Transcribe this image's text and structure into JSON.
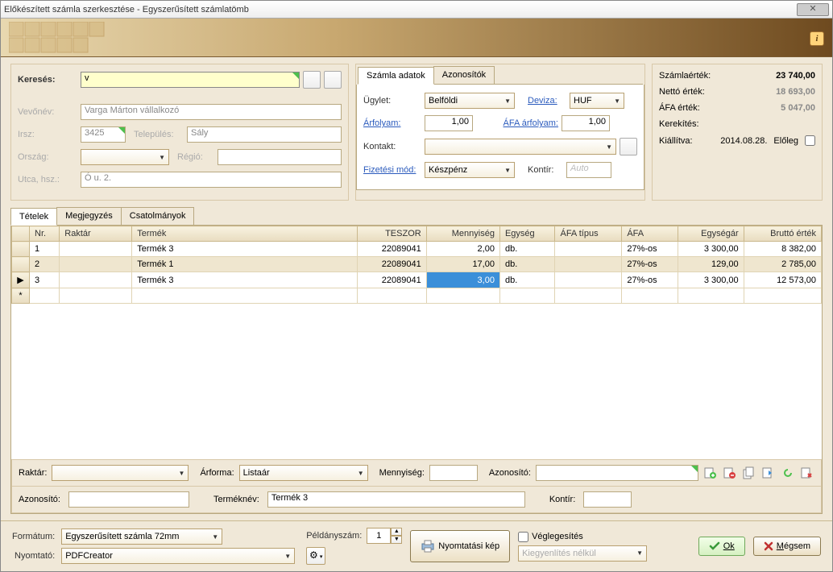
{
  "window": {
    "title": "Előkészített számla szerkesztése - Egyszerűsített számlatömb"
  },
  "search": {
    "label": "Keresés:",
    "value": "v"
  },
  "customer": {
    "name_label": "Vevőnév:",
    "name": "Varga Márton vállalkozó",
    "zip_label": "Irsz:",
    "zip": "3425",
    "city_label": "Település:",
    "city": "Sály",
    "country_label": "Ország:",
    "country": "",
    "region_label": "Régió:",
    "region": "",
    "street_label": "Utca, hsz.:",
    "street": "Ó u. 2."
  },
  "midtabs": {
    "tab1": "Számla adatok",
    "tab2": "Azonosítók"
  },
  "deal": {
    "type_label": "Ügylet:",
    "type_value": "Belföldi",
    "currency_label": "Deviza:",
    "currency_value": "HUF",
    "rate_label": "Árfolyam:",
    "rate_value": "1,00",
    "vat_rate_label": "ÁFA árfolyam:",
    "vat_rate_value": "1,00",
    "contact_label": "Kontakt:",
    "contact_value": "",
    "paymode_label": "Fizetési mód:",
    "paymode_value": "Készpénz",
    "kontir_label": "Kontír:",
    "kontir_value": "Auto"
  },
  "totals": {
    "gross_label": "Számlaérték:",
    "gross": "23 740,00",
    "net_label": "Nettó érték:",
    "net": "18 693,00",
    "vat_label": "ÁFA érték:",
    "vat": "5 047,00",
    "round_label": "Kerekítés:",
    "issued_label": "Kiállítva:",
    "issued": "2014.08.28.",
    "prepay_label": "Előleg"
  },
  "maintabs": {
    "t1": "Tételek",
    "t2": "Megjegyzés",
    "t3": "Csatolmányok"
  },
  "grid": {
    "cols": {
      "nr": "Nr.",
      "raktar": "Raktár",
      "termek": "Termék",
      "teszor": "TESZOR",
      "menny": "Mennyiség",
      "egyseg": "Egység",
      "afatipus": "ÁFA típus",
      "afa": "ÁFA",
      "egysegar": "Egységár",
      "brutto": "Bruttó érték"
    },
    "rows": [
      {
        "nr": "1",
        "raktar": "",
        "termek": "Termék 3",
        "teszor": "22089041",
        "menny": "2,00",
        "egyseg": "db.",
        "afatipus": "",
        "afa": "27%-os",
        "egysegar": "3 300,00",
        "brutto": "8 382,00"
      },
      {
        "nr": "2",
        "raktar": "",
        "termek": "Termék 1",
        "teszor": "22089041",
        "menny": "17,00",
        "egyseg": "db.",
        "afatipus": "",
        "afa": "27%-os",
        "egysegar": "129,00",
        "brutto": "2 785,00"
      },
      {
        "nr": "3",
        "raktar": "",
        "termek": "Termék 3",
        "teszor": "22089041",
        "menny": "3,00",
        "egyseg": "db.",
        "afatipus": "",
        "afa": "27%-os",
        "egysegar": "3 300,00",
        "brutto": "12 573,00"
      }
    ],
    "selected_cell": "3,00"
  },
  "lower1": {
    "raktar_label": "Raktár:",
    "arforma_label": "Árforma:",
    "arforma_value": "Listaár",
    "menny_label": "Mennyiség:",
    "azon_label": "Azonosító:"
  },
  "lower2": {
    "azon_label": "Azonosító:",
    "termeknev_label": "Terméknév:",
    "termeknev_value": "Termék 3",
    "kontir_label": "Kontír:"
  },
  "footer": {
    "format_label": "Formátum:",
    "format_value": "Egyszerűsített számla 72mm",
    "copies_label": "Példányszám:",
    "copies_value": "1",
    "printer_label": "Nyomtató:",
    "printer_value": "PDFCreator",
    "preview_btn": "Nyomtatási kép",
    "finalize_label": "Véglegesítés",
    "settle_value": "Kiegyenlítés nélkül",
    "ok": "Ok",
    "cancel": "Mégsem"
  }
}
